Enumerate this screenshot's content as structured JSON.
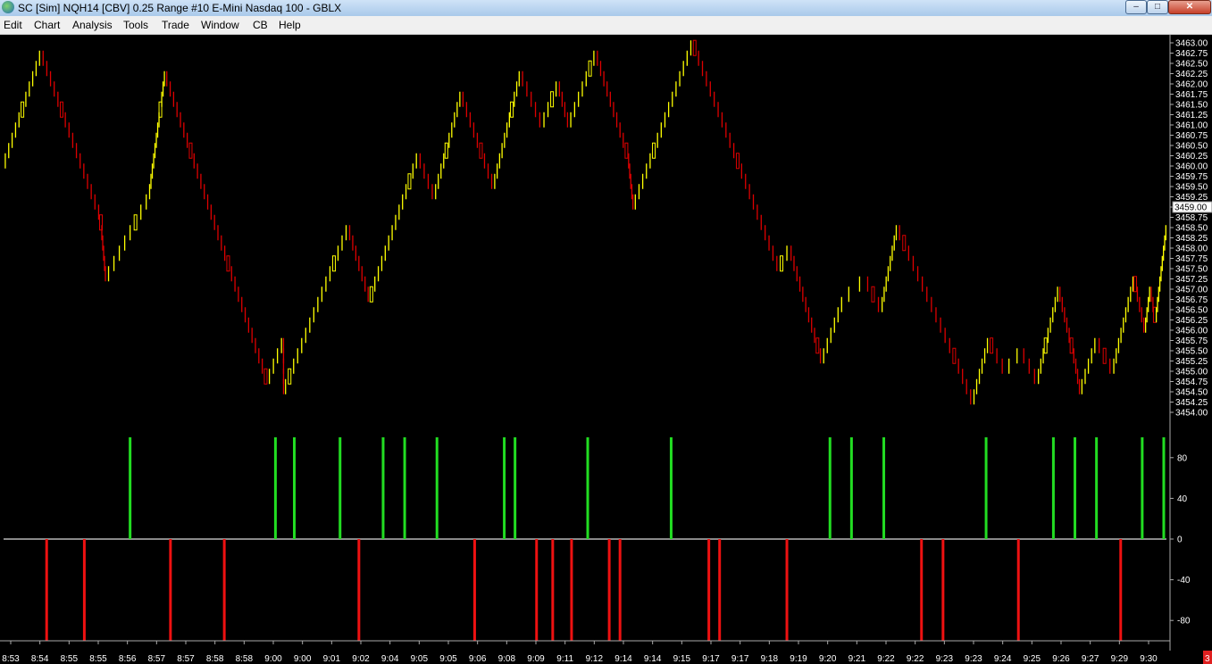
{
  "window": {
    "title": "SC [Sim] NQH14 [CBV]  0.25 Range  #10  E-Mini Nasdaq 100 - GBLX",
    "buttons": {
      "minimize": "–",
      "maximize": "□",
      "close": "✕"
    }
  },
  "menu": [
    {
      "id": "edit",
      "label": "Edit"
    },
    {
      "id": "chart",
      "label": "Chart"
    },
    {
      "id": "analysis",
      "label": "Analysis"
    },
    {
      "id": "tools",
      "label": "Tools"
    },
    {
      "id": "trade",
      "label": "Trade"
    },
    {
      "id": "window",
      "label": "Window"
    },
    {
      "id": "cb",
      "label": "CB"
    },
    {
      "id": "help",
      "label": "Help"
    }
  ],
  "status": {
    "corner_badge": "3"
  },
  "chart_data": {
    "type": "line",
    "price_panel": {
      "y_ticks": [
        "3463.00",
        "3462.75",
        "3462.50",
        "3462.25",
        "3462.00",
        "3461.75",
        "3461.50",
        "3461.25",
        "3461.00",
        "3460.75",
        "3460.50",
        "3460.25",
        "3460.00",
        "3459.75",
        "3459.50",
        "3459.25",
        "3459.00",
        "3458.75",
        "3458.50",
        "3458.25",
        "3458.00",
        "3457.75",
        "3457.50",
        "3457.25",
        "3457.00",
        "3456.75",
        "3456.50",
        "3456.25",
        "3456.00",
        "3455.75",
        "3455.50",
        "3455.25",
        "3455.00",
        "3454.75",
        "3454.50",
        "3454.25",
        "3454.00"
      ],
      "ylim": [
        3454.0,
        3463.0
      ],
      "current_price": "3459.00",
      "series": [
        {
          "name": "up bars",
          "color": "#ffff00"
        },
        {
          "name": "down bars",
          "color": "#dd0000"
        }
      ],
      "path_points": [
        {
          "x": 0,
          "y": 3460.0
        },
        {
          "x": 7,
          "y": 3462.75
        },
        {
          "x": 18,
          "y": 3458.75
        },
        {
          "x": 19,
          "y": 3457.25
        },
        {
          "x": 27,
          "y": 3459.25
        },
        {
          "x": 30,
          "y": 3462.25
        },
        {
          "x": 49,
          "y": 3454.75
        },
        {
          "x": 52,
          "y": 3455.75
        },
        {
          "x": 52,
          "y": 3454.5
        },
        {
          "x": 64,
          "y": 3458.5
        },
        {
          "x": 68,
          "y": 3456.75
        },
        {
          "x": 77,
          "y": 3460.25
        },
        {
          "x": 80,
          "y": 3459.25
        },
        {
          "x": 85,
          "y": 3461.75
        },
        {
          "x": 91,
          "y": 3459.5
        },
        {
          "x": 96,
          "y": 3462.25
        },
        {
          "x": 100,
          "y": 3461.0
        },
        {
          "x": 103,
          "y": 3462.0
        },
        {
          "x": 105,
          "y": 3461.0
        },
        {
          "x": 110,
          "y": 3462.75
        },
        {
          "x": 116,
          "y": 3460.25
        },
        {
          "x": 117,
          "y": 3459.0
        },
        {
          "x": 128,
          "y": 3463.0
        },
        {
          "x": 144,
          "y": 3457.5
        },
        {
          "x": 146,
          "y": 3458.0
        },
        {
          "x": 152,
          "y": 3455.25
        },
        {
          "x": 156,
          "y": 3456.75
        },
        {
          "x": 160,
          "y": 3457.25
        },
        {
          "x": 163,
          "y": 3456.5
        },
        {
          "x": 166,
          "y": 3458.5
        },
        {
          "x": 177,
          "y": 3455.25
        },
        {
          "x": 180,
          "y": 3454.25
        },
        {
          "x": 183,
          "y": 3455.75
        },
        {
          "x": 186,
          "y": 3455.0
        },
        {
          "x": 189,
          "y": 3455.5
        },
        {
          "x": 192,
          "y": 3454.75
        },
        {
          "x": 196,
          "y": 3457.0
        },
        {
          "x": 199,
          "y": 3455.25
        },
        {
          "x": 200,
          "y": 3454.5
        },
        {
          "x": 203,
          "y": 3455.75
        },
        {
          "x": 206,
          "y": 3455.0
        },
        {
          "x": 210,
          "y": 3457.25
        },
        {
          "x": 212,
          "y": 3456.0
        },
        {
          "x": 213,
          "y": 3457.0
        },
        {
          "x": 214,
          "y": 3456.25
        },
        {
          "x": 216,
          "y": 3458.5
        }
      ]
    },
    "histogram_panel": {
      "y_ticks": [
        "80",
        "40",
        "0",
        "-40",
        "-80"
      ],
      "ylim": [
        -100,
        100
      ],
      "bar_height": 100,
      "up_color": "#22dd22",
      "down_color": "#ee1111",
      "up_bars_at": [
        23.5,
        50.5,
        54,
        62.5,
        70.5,
        74.5,
        80.5,
        93,
        95,
        108.5,
        124,
        153.5,
        157.5,
        163.5,
        182.5,
        195,
        199,
        203,
        211.5,
        215.5
      ],
      "down_bars_at": [
        8,
        15,
        31,
        41,
        66,
        87.5,
        99,
        102,
        105.5,
        112.5,
        114.5,
        131,
        133,
        145.5,
        170.5,
        174.5,
        188.5,
        207.5
      ]
    },
    "x_ticks": [
      "8:53",
      "8:54",
      "8:55",
      "8:55",
      "8:56",
      "8:57",
      "8:57",
      "8:58",
      "8:58",
      "9:00",
      "9:00",
      "9:01",
      "9:02",
      "9:04",
      "9:05",
      "9:05",
      "9:06",
      "9:08",
      "9:09",
      "9:11",
      "9:12",
      "9:14",
      "9:14",
      "9:15",
      "9:17",
      "9:17",
      "9:18",
      "9:19",
      "9:20",
      "9:21",
      "9:22",
      "9:22",
      "9:23",
      "9:23",
      "9:24",
      "9:25",
      "9:26",
      "9:27",
      "9:29",
      "9:30"
    ],
    "x_range": [
      0,
      216
    ],
    "grid": false
  }
}
